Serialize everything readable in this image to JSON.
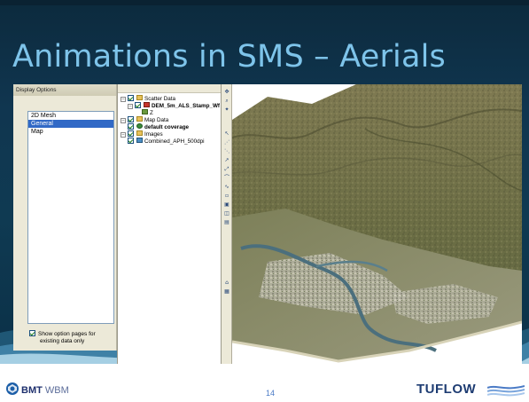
{
  "slide": {
    "title": "Animations in SMS – Aerials",
    "page_number": "14",
    "colors": {
      "band": "#0f3a52",
      "title": "#7ec4ea",
      "page_number": "#4b7bc6"
    }
  },
  "dialog": {
    "title": "Display Options",
    "options": [
      {
        "label": "2D Mesh",
        "selected": false
      },
      {
        "label": "General",
        "selected": true
      },
      {
        "label": "Map",
        "selected": false
      }
    ],
    "show_pages_label_line1": "Show option pages for",
    "show_pages_label_line2": "existing data only"
  },
  "explorer": {
    "scatter_data": "Scatter Data",
    "dem": "DEM_5m_ALS_Stamp_Wf",
    "z": "Z",
    "map_data": "Map Data",
    "coverage": "default coverage",
    "images": "Images",
    "image_item": "Combined_APH_500dpi"
  },
  "footer": {
    "bmt_bold": "BMT",
    "bmt_rest": " WBM",
    "tuflow": "TUFLOW"
  },
  "icons": [
    "bmt-logo-icon",
    "tuflow-waves-icon",
    "expand-icon",
    "folder-icon",
    "checkbox-icon",
    "toolbar-tool-icon"
  ]
}
